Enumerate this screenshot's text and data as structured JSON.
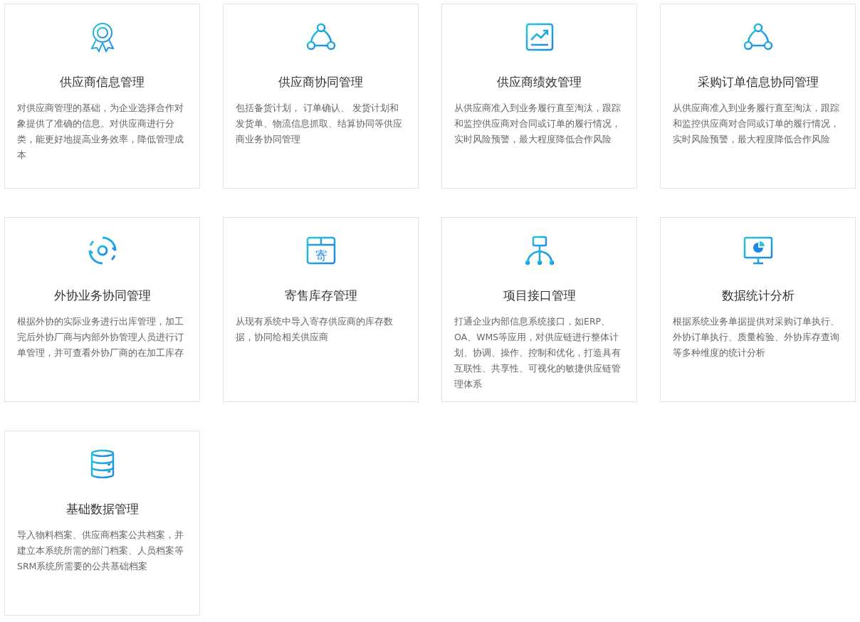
{
  "cards": [
    {
      "title": "供应商信息管理",
      "description": "对供应商管理的基础，为企业选择合作对象提供了准确的信息。对供应商进行分类，能更好地提高业务效率，降低管理成本"
    },
    {
      "title": "供应商协同管理",
      "description": "包括备货计划， 订单确认、 发货计划和发货单、物流信息抓取、结算协同等供应商业务协同管理"
    },
    {
      "title": "供应商绩效管理",
      "description": "从供应商准入到业务履行直至淘汰，跟踪和监控供应商对合同或订单的履行情况，实时风险预警，最大程度降低合作风险"
    },
    {
      "title": "采购订单信息协同管理",
      "description": "从供应商准入到业务履行直至淘汰，跟踪和监控供应商对合同或订单的履行情况，实时风险预警，最大程度降低合作风险"
    },
    {
      "title": "外协业务协同管理",
      "description": "根据外协的实际业务进行出库管理，加工完后外协厂商与内部外协管理人员进行订单管理，并可查看外协厂商的在加工库存"
    },
    {
      "title": "寄售库存管理",
      "icon_text": "寄",
      "description": "从现有系统中导入寄存供应商的库存数据，协同给相关供应商"
    },
    {
      "title": "项目接口管理",
      "description": "打通企业内部信息系统接口，如ERP、OA、WMS等应用，对供应链进行整体计划、协调、操作、控制和优化，打造具有互联性、共享性、可视化的敏捷供应链管理体系"
    },
    {
      "title": "数据统计分析",
      "description": "根据系统业务单据提供对采购订单执行、外协订单执行、质量检验、外协库存查询等多种维度的统计分析"
    },
    {
      "title": "基础数据管理",
      "description": "导入物料档案、供应商档案公共档案，并建立本系统所需的部门档案、人员档案等SRM系统所需要的公共基础档案"
    }
  ]
}
